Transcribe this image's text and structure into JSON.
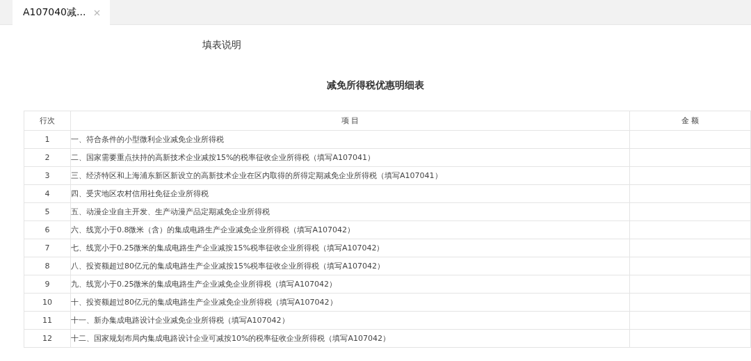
{
  "tabs": [
    {
      "label": "A107040减...",
      "selected": true,
      "closable": true
    }
  ],
  "instructions_link": "填表说明",
  "title": "减免所得税优惠明细表",
  "table": {
    "columns": [
      "行次",
      "项 目",
      "金 额"
    ],
    "rows": [
      {
        "line": "1",
        "item": "一、符合条件的小型微利企业减免企业所得税"
      },
      {
        "line": "2",
        "item": "二、国家需要重点扶持的高新技术企业减按15%的税率征收企业所得税（填写A107041）"
      },
      {
        "line": "3",
        "item": "三、经济特区和上海浦东新区新设立的高新技术企业在区内取得的所得定期减免企业所得税（填写A107041）"
      },
      {
        "line": "4",
        "item": "四、受灾地区农村信用社免征企业所得税"
      },
      {
        "line": "5",
        "item": "五、动漫企业自主开发、生产动漫产品定期减免企业所得税"
      },
      {
        "line": "6",
        "item": "六、线宽小于0.8微米（含）的集成电路生产企业减免企业所得税（填写A107042）"
      },
      {
        "line": "7",
        "item": "七、线宽小于0.25微米的集成电路生产企业减按15%税率征收企业所得税（填写A107042）"
      },
      {
        "line": "8",
        "item": "八、投资额超过80亿元的集成电路生产企业减按15%税率征收企业所得税（填写A107042）"
      },
      {
        "line": "9",
        "item": "九、线宽小于0.25微米的集成电路生产企业减免企业所得税（填写A107042）"
      },
      {
        "line": "10",
        "item": "十、投资额超过80亿元的集成电路生产企业减免企业所得税（填写A107042）"
      },
      {
        "line": "11",
        "item": "十一、新办集成电路设计企业减免企业所得税（填写A107042）"
      },
      {
        "line": "12",
        "item": "十二、国家规划布局内集成电路设计企业可减按10%的税率征收企业所得税（填写A107042）"
      }
    ]
  }
}
